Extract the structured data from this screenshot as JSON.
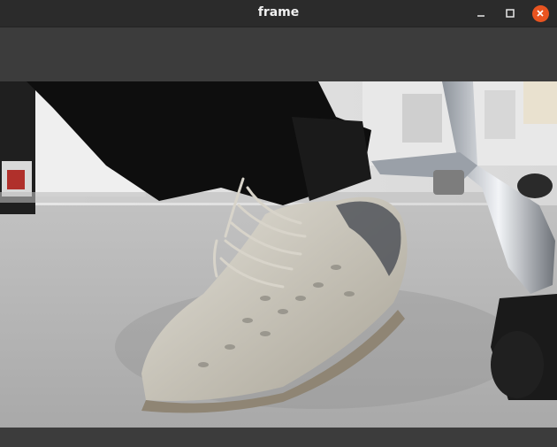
{
  "window": {
    "title": "frame",
    "buttons": {
      "minimize_icon": "minimize-icon",
      "maximize_icon": "maximize-icon",
      "close_icon": "close-icon"
    },
    "accent_close": "#e95420"
  },
  "image": {
    "description_icon": "camera-frame"
  }
}
